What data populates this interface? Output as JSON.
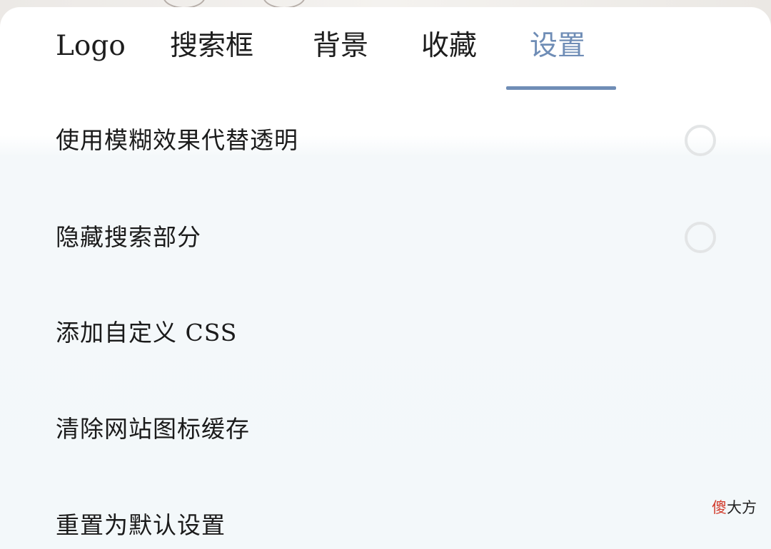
{
  "tabs": [
    {
      "label": "Logo",
      "active": false
    },
    {
      "label": "搜索框",
      "active": false
    },
    {
      "label": "背景",
      "active": false
    },
    {
      "label": "收藏",
      "active": false
    },
    {
      "label": "设置",
      "active": true
    }
  ],
  "settings": {
    "items": [
      {
        "label": "使用模糊效果代替透明",
        "toggle": "off"
      },
      {
        "label": "隐藏搜索部分",
        "toggle": "off"
      },
      {
        "label": "添加自定义 CSS"
      },
      {
        "label": "清除网站图标缓存"
      },
      {
        "label": "重置为默认设置"
      }
    ]
  },
  "watermark": {
    "first": "傻",
    "rest": "大方"
  },
  "colors": {
    "accent": "#6f8db6",
    "text": "#1d1d1d",
    "radio_border": "#e3e5e6",
    "watermark_red": "#d23a2a"
  }
}
